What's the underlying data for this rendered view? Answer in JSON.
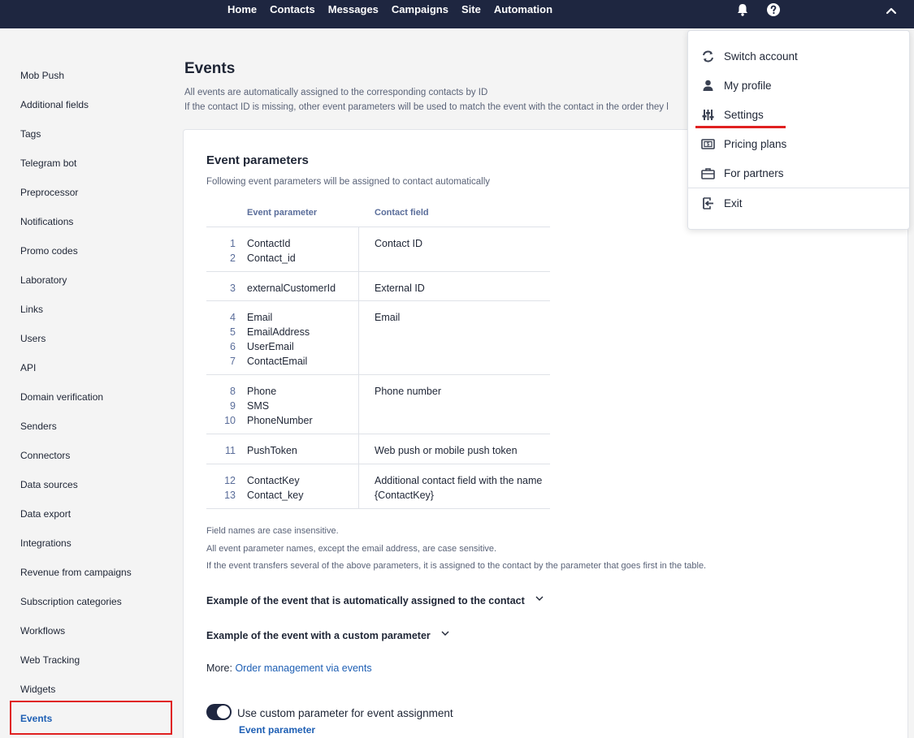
{
  "nav": [
    "Home",
    "Contacts",
    "Messages",
    "Campaigns",
    "Site",
    "Automation"
  ],
  "icons": {
    "bell": "bell-icon",
    "help": "help-icon",
    "chevron": "chevron-up-icon"
  },
  "sidebar": [
    "Mob Push",
    "Additional fields",
    "Tags",
    "Telegram bot",
    "Preprocessor",
    "Notifications",
    "Promo codes",
    "Laboratory",
    "Links",
    "Users",
    "API",
    "Domain verification",
    "Senders",
    "Connectors",
    "Data sources",
    "Data export",
    "Integrations",
    "Revenue from campaigns",
    "Subscription categories",
    "Workflows",
    "Web Tracking",
    "Widgets",
    "Events"
  ],
  "page": {
    "title": "Events",
    "desc1": "All events are automatically assigned to the corresponding contacts by ID",
    "desc2": "If the contact ID is missing, other event parameters will be used to match the event with the contact in the order they l"
  },
  "card": {
    "title": "Event parameters",
    "subtitle": "Following event parameters will be assigned to contact automatically",
    "col1": "Event parameter",
    "col2": "Contact field",
    "rows": [
      {
        "params": [
          [
            "1",
            "ContactId"
          ],
          [
            "2",
            "Contact_id"
          ]
        ],
        "field": "Contact ID"
      },
      {
        "params": [
          [
            "3",
            "externalCustomerId"
          ]
        ],
        "field": "External ID"
      },
      {
        "params": [
          [
            "4",
            "Email"
          ],
          [
            "5",
            "EmailAddress"
          ],
          [
            "6",
            "UserEmail"
          ],
          [
            "7",
            "ContactEmail"
          ]
        ],
        "field": "Email"
      },
      {
        "params": [
          [
            "8",
            "Phone"
          ],
          [
            "9",
            "SMS"
          ],
          [
            "10",
            "PhoneNumber"
          ]
        ],
        "field": "Phone number"
      },
      {
        "params": [
          [
            "11",
            "PushToken"
          ]
        ],
        "field": "Web push or mobile push token"
      },
      {
        "params": [
          [
            "12",
            "ContactKey"
          ],
          [
            "13",
            "Contact_key"
          ]
        ],
        "field": "Additional contact field with the name {ContactKey}"
      }
    ],
    "note1": "Field names are case insensitive.",
    "note2": "All event parameter names, except the email address, are case sensitive.",
    "note3": "If the event transfers several of the above parameters, it is assigned to the contact by the parameter that goes first in the table.",
    "example1": "Example of the event that is automatically assigned to the contact",
    "example2": "Example of the event with a custom parameter",
    "more_label": "More:",
    "more_link": "Order management via events",
    "toggle_label": "Use custom parameter for event assignment",
    "event_param_label": "Event parameter"
  },
  "menu": [
    {
      "label": "Switch account",
      "icon": "refresh-icon"
    },
    {
      "label": "My profile",
      "icon": "user-icon"
    },
    {
      "label": "Settings",
      "icon": "sliders-icon"
    },
    {
      "label": "Pricing plans",
      "icon": "pricing-icon"
    },
    {
      "label": "For partners",
      "icon": "briefcase-icon"
    },
    {
      "label": "Exit",
      "icon": "exit-icon"
    }
  ],
  "colors": {
    "accent": "#1e5fb4",
    "topbar": "#1e2640",
    "highlight": "#e02020"
  }
}
